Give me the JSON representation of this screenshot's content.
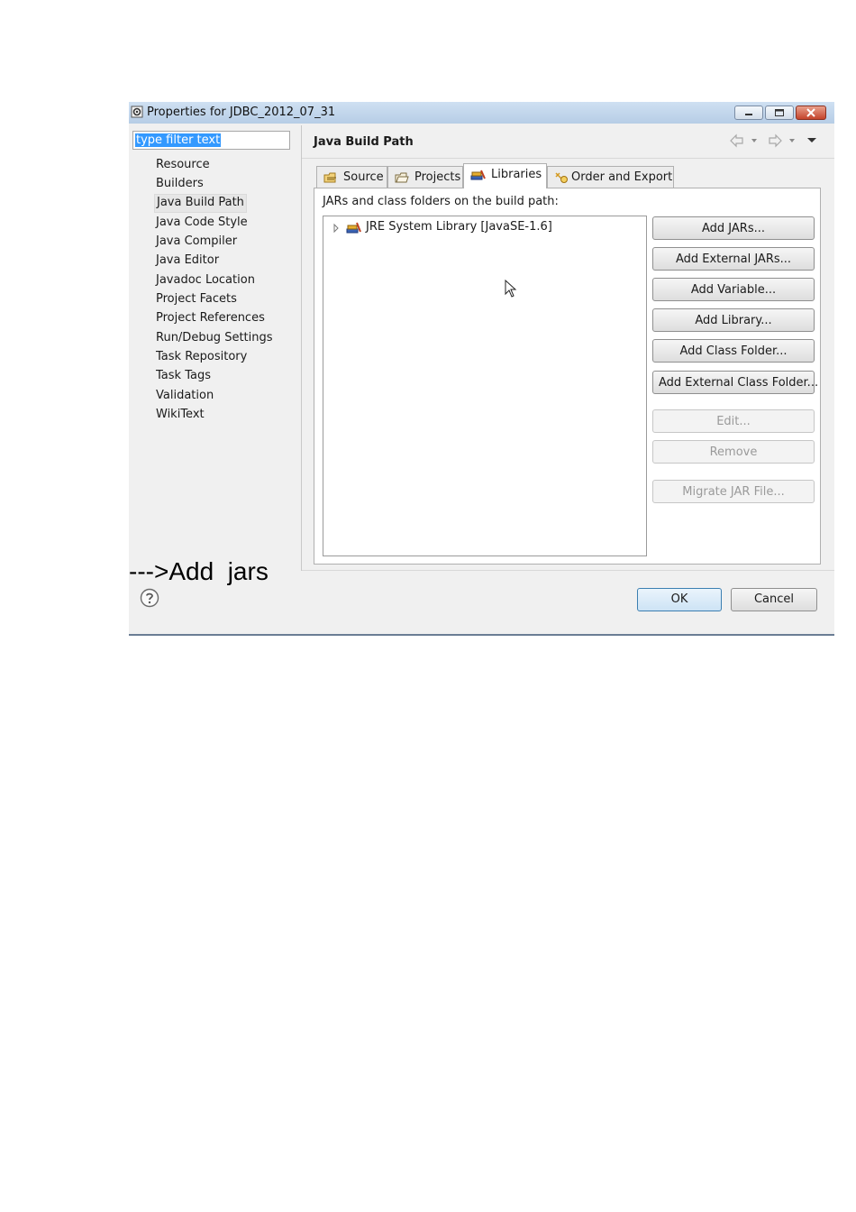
{
  "window": {
    "title": "Properties for JDBC_2012_07_31"
  },
  "filter": {
    "text": "type filter text"
  },
  "nav": {
    "items": [
      {
        "label": "Resource"
      },
      {
        "label": "Builders"
      },
      {
        "label": "Java Build Path",
        "selected": true
      },
      {
        "label": "Java Code Style"
      },
      {
        "label": "Java Compiler"
      },
      {
        "label": "Java Editor"
      },
      {
        "label": "Javadoc Location"
      },
      {
        "label": "Project Facets"
      },
      {
        "label": "Project References"
      },
      {
        "label": "Run/Debug Settings"
      },
      {
        "label": "Task Repository"
      },
      {
        "label": "Task Tags"
      },
      {
        "label": "Validation"
      },
      {
        "label": "WikiText"
      }
    ]
  },
  "page": {
    "title": "Java Build Path"
  },
  "tabs": [
    {
      "label": "Source",
      "icon": "source-folder-icon"
    },
    {
      "label": "Projects",
      "icon": "projects-folder-icon"
    },
    {
      "label": "Libraries",
      "icon": "libraries-icon",
      "active": true
    },
    {
      "label": "Order and Export",
      "icon": "order-export-icon"
    }
  ],
  "libraries": {
    "description": "JARs and class folders on the build path:",
    "entries": [
      {
        "label": "JRE System Library [JavaSE-1.6]",
        "icon": "library-icon"
      }
    ]
  },
  "buttons": {
    "add_jars": "Add JARs...",
    "add_external_jars": "Add External JARs...",
    "add_variable": "Add Variable...",
    "add_library": "Add Library...",
    "add_class_folder": "Add Class Folder...",
    "add_external_class_folder": "Add External Class Folder...",
    "edit": "Edit...",
    "remove": "Remove",
    "migrate_jar": "Migrate JAR File..."
  },
  "footer": {
    "ok": "OK",
    "cancel": "Cancel"
  },
  "annotation": "--->Add  jars",
  "colors": {
    "selection": "#3399ff",
    "title_bar": "#c4d8ee",
    "close_button": "#c4442c",
    "ok_border": "#3c7fb1"
  }
}
